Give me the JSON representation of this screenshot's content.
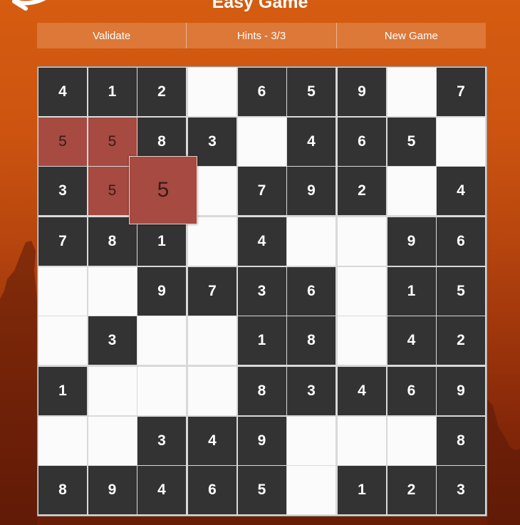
{
  "header": {
    "title": "Easy Game"
  },
  "toolbar": {
    "validate_label": "Validate",
    "hints_label": "Hints - 3/3",
    "new_game_label": "New Game"
  },
  "board": {
    "rows": [
      [
        "4",
        "1",
        "2",
        "",
        "6",
        "5",
        "9",
        "",
        "7"
      ],
      [
        "5",
        "5",
        "8",
        "3",
        "",
        "4",
        "6",
        "5",
        ""
      ],
      [
        "3",
        "5",
        "5",
        "",
        "7",
        "9",
        "2",
        "",
        "4"
      ],
      [
        "7",
        "8",
        "1",
        "",
        "4",
        "",
        "",
        "9",
        "6"
      ],
      [
        "",
        "",
        "9",
        "7",
        "3",
        "6",
        "",
        "1",
        "5"
      ],
      [
        "",
        "3",
        "",
        "",
        "1",
        "8",
        "",
        "4",
        "2"
      ],
      [
        "1",
        "",
        "",
        "",
        "8",
        "3",
        "4",
        "6",
        "9"
      ],
      [
        "",
        "",
        "3",
        "4",
        "9",
        "",
        "",
        "",
        "8"
      ],
      [
        "8",
        "9",
        "4",
        "6",
        "5",
        "",
        "1",
        "2",
        "3"
      ]
    ],
    "states": [
      [
        "given",
        "given",
        "given",
        "empty",
        "given",
        "given",
        "given",
        "empty",
        "given"
      ],
      [
        "conflict",
        "conflict",
        "given",
        "given",
        "empty",
        "given",
        "given",
        "given",
        "empty"
      ],
      [
        "given",
        "conflict",
        "selected",
        "empty",
        "given",
        "given",
        "given",
        "empty",
        "given"
      ],
      [
        "given",
        "given",
        "given",
        "empty",
        "given",
        "empty",
        "empty",
        "given",
        "given"
      ],
      [
        "empty",
        "empty",
        "given",
        "given",
        "given",
        "given",
        "empty",
        "given",
        "given"
      ],
      [
        "empty",
        "given",
        "empty",
        "empty",
        "given",
        "given",
        "empty",
        "given",
        "given"
      ],
      [
        "given",
        "empty",
        "empty",
        "empty",
        "given",
        "given",
        "given",
        "given",
        "given"
      ],
      [
        "empty",
        "empty",
        "given",
        "given",
        "given",
        "empty",
        "empty",
        "empty",
        "given"
      ],
      [
        "given",
        "given",
        "given",
        "given",
        "given",
        "empty",
        "given",
        "given",
        "given"
      ]
    ],
    "selected_cell": {
      "row": 2,
      "col": 2
    }
  },
  "colors": {
    "given_cell": "#333333",
    "empty_cell": "#fbfbfb",
    "conflict_cell": "#a64a42",
    "toolbar": "#dc7838",
    "background_top": "#d55c10",
    "background_bottom": "#6a1c06"
  },
  "icons": {
    "back": "back-arrow-icon"
  }
}
